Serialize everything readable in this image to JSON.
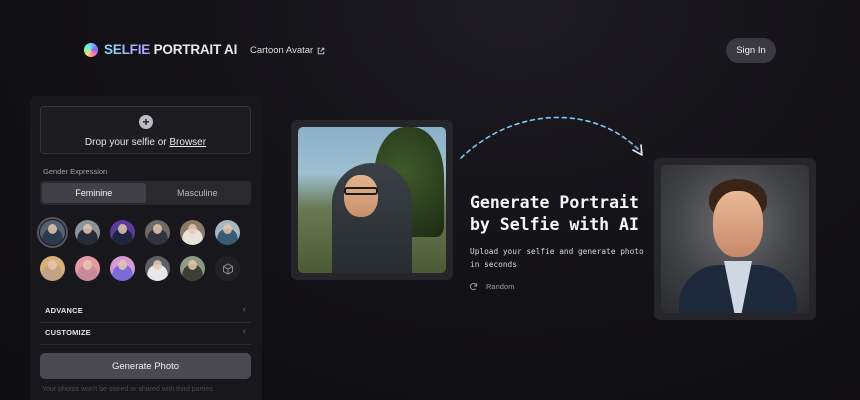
{
  "header": {
    "logo_text_a": "SELFIE",
    "logo_text_b": " PORTRAIT AI",
    "nav_link": "Cartoon Avatar",
    "signin_label": "Sign In"
  },
  "upload": {
    "drop_prefix": "Drop your selfie or ",
    "drop_link": "Browser"
  },
  "gender": {
    "label": "Gender Expression",
    "options": [
      "Feminine",
      "Masculine"
    ],
    "selected": "Feminine"
  },
  "sections": {
    "advance": "ADVANCE",
    "customize": "CUSTOMIZE"
  },
  "generate_label": "Generate Photo",
  "privacy_note": "Your photos won't be stored or shared with third parties",
  "hero": {
    "title_line1": "Generate Portrait",
    "title_line2": "by Selfie with AI",
    "subtitle": "Upload your selfie and generate photo in seconds",
    "random_label": "Random"
  },
  "colors": {
    "accent_arrow": "#7ec8f0",
    "button_bg": "#4a4950"
  }
}
